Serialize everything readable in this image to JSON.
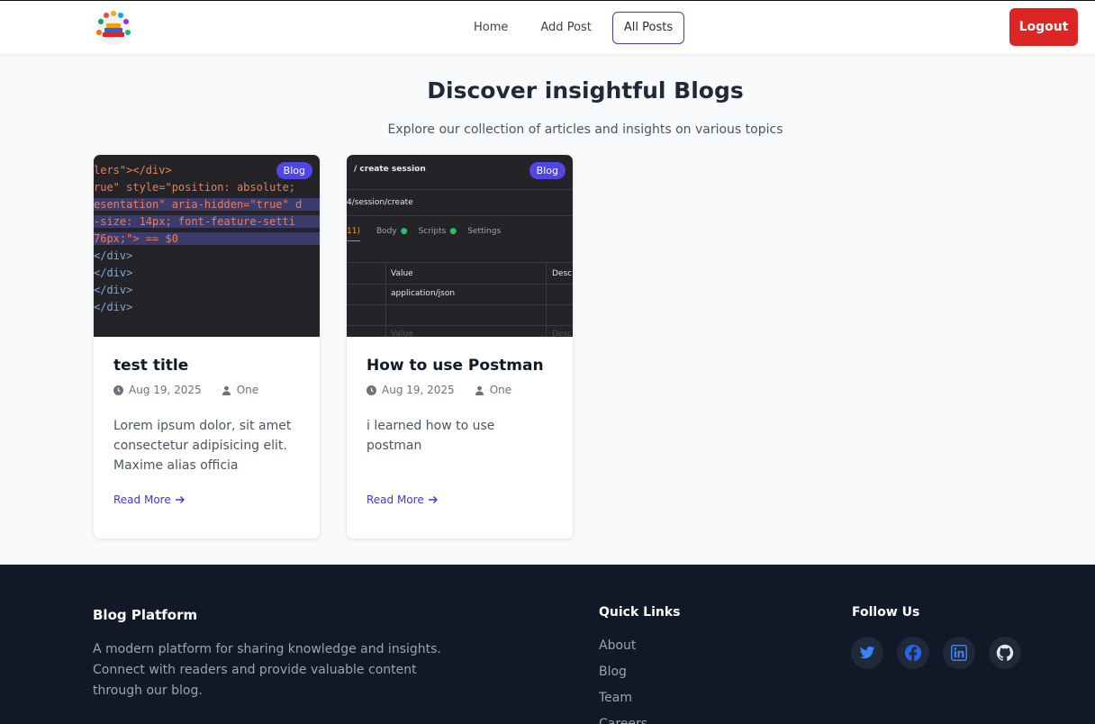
{
  "nav": {
    "links": [
      "Home",
      "Add Post",
      "All Posts"
    ],
    "active": "All Posts",
    "logout": "Logout"
  },
  "hero": {
    "title": "Discover insightful Blogs",
    "subtitle": "Explore our collection of articles and insights on various topics"
  },
  "posts": [
    {
      "badge": "Blog",
      "title": "test title",
      "date": "Aug 19, 2025",
      "author": "One",
      "excerpt": "Lorem ipsum dolor, sit amet consectetur adipisicing elit. Maxime alias officia consecte…",
      "read_more": "Read More",
      "thumb_lines": [
        "lers\"></div>",
        "rue\" style=\"position: absolute;",
        "esentation\" aria-hidden=\"true\" d",
        "-size: 14px; font-feature-setti",
        "76px;\"> == $0",
        "</div>",
        "</div>",
        "</div>",
        "</div>"
      ]
    },
    {
      "badge": "Blog",
      "title": "How to use Postman",
      "date": "Aug 19, 2025",
      "author": "One",
      "excerpt": "i learned how to use postman",
      "read_more": "Read More",
      "thumb": {
        "crumb": "/ create session",
        "url": "4/session/create",
        "tabs": [
          "11)",
          "Body",
          "Scripts",
          "Settings"
        ],
        "col_value": "Value",
        "col_desc": "Desc",
        "cell": "application/json",
        "ghost_value": "Value",
        "ghost_desc": "Desc"
      }
    }
  ],
  "footer": {
    "brand": "Blog Platform",
    "description": "A modern platform for sharing knowledge and insights. Connect with readers and provide valuable content through our blog.",
    "quick_links_title": "Quick Links",
    "quick_links": [
      "About",
      "Blog",
      "Team",
      "Careers"
    ],
    "follow_title": "Follow Us",
    "socials": [
      "twitter-icon",
      "facebook-icon",
      "linkedin-icon",
      "github-icon"
    ]
  },
  "colors": {
    "accent": "#4f46e5",
    "logout": "#dc2626",
    "footer_bg": "#111827",
    "social_blue": "#3b82f6"
  }
}
